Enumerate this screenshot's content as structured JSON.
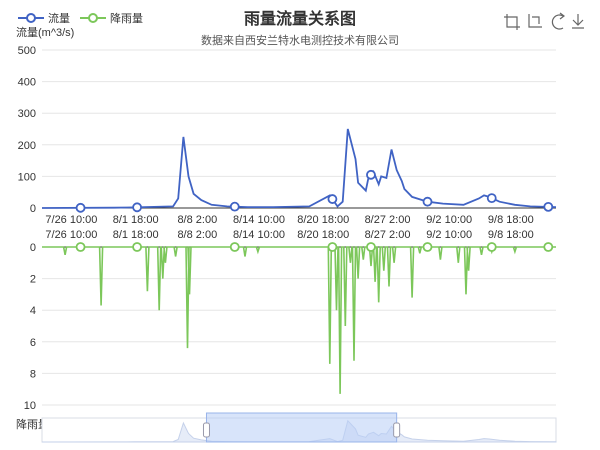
{
  "title": "雨量流量关系图",
  "subtitle": "数据来自西安兰特水电测控技术有限公司",
  "legend": [
    {
      "name": "流量",
      "color": "#4063c4"
    },
    {
      "name": "降雨量",
      "color": "#7cc75a"
    }
  ],
  "toolbox": [
    {
      "name": "zoom-icon"
    },
    {
      "name": "zoom-reset-icon"
    },
    {
      "name": "restore-icon"
    },
    {
      "name": "download-icon"
    }
  ],
  "chart_data": [
    {
      "type": "line",
      "ylabel": "流量(m^3/s)",
      "ylim": [
        0,
        500
      ],
      "yticks": [
        "0",
        "100",
        "200",
        "300",
        "400",
        "500"
      ],
      "xlim": [
        0,
        1
      ],
      "xtick_labels": [
        "7/26 10:00",
        "8/1 18:00",
        "8/8 2:00",
        "8/14 10:00",
        "8/20 18:00",
        "8/27 2:00",
        "9/2 10:00",
        "9/8 18:00"
      ],
      "grid": true,
      "series": [
        {
          "name": "流量",
          "color": "#4063c4",
          "x": [
            0,
            0.14,
            0.18,
            0.255,
            0.265,
            0.275,
            0.285,
            0.295,
            0.31,
            0.33,
            0.36,
            0.4,
            0.45,
            0.52,
            0.56,
            0.575,
            0.585,
            0.595,
            0.61,
            0.615,
            0.63,
            0.635,
            0.645,
            0.655,
            0.66,
            0.67,
            0.68,
            0.69,
            0.7,
            0.705,
            0.72,
            0.75,
            0.78,
            0.82,
            0.85,
            0.86,
            0.87,
            0.89,
            0.92,
            0.95,
            1.0
          ],
          "values": [
            0,
            1,
            2,
            5,
            30,
            225,
            100,
            45,
            25,
            10,
            5,
            3,
            3,
            5,
            40,
            5,
            20,
            250,
            155,
            80,
            55,
            95,
            115,
            75,
            100,
            95,
            185,
            120,
            85,
            60,
            35,
            20,
            14,
            10,
            30,
            40,
            35,
            20,
            10,
            5,
            3
          ]
        }
      ],
      "markers": [
        0.075,
        0.185,
        0.375,
        0.565,
        0.64,
        0.75,
        0.875,
        0.985
      ]
    },
    {
      "type": "line",
      "ylabel": "降雨量(mm)",
      "ylim": [
        0,
        10
      ],
      "inverted": true,
      "yticks": [
        "0",
        "2",
        "4",
        "6",
        "8",
        "10"
      ],
      "xlim": [
        0,
        1
      ],
      "xtick_labels": [
        "7/26 10:00",
        "8/1 18:00",
        "8/8 2:00",
        "8/14 10:00",
        "8/20 18:00",
        "8/27 2:00",
        "9/2 10:00",
        "9/8 18:00"
      ],
      "grid": true,
      "series": [
        {
          "name": "降雨量",
          "color": "#7cc75a",
          "spikes": [
            [
              0.045,
              0.5
            ],
            [
              0.115,
              3.7
            ],
            [
              0.205,
              2.8
            ],
            [
              0.228,
              4.0
            ],
            [
              0.235,
              2.0
            ],
            [
              0.24,
              1.0
            ],
            [
              0.26,
              0.6
            ],
            [
              0.283,
              6.4
            ],
            [
              0.287,
              3.0
            ],
            [
              0.395,
              0.6
            ],
            [
              0.42,
              0.3
            ],
            [
              0.56,
              7.4
            ],
            [
              0.573,
              4.0
            ],
            [
              0.58,
              9.3
            ],
            [
              0.59,
              5.0
            ],
            [
              0.6,
              1.0
            ],
            [
              0.607,
              7.2
            ],
            [
              0.615,
              2.0
            ],
            [
              0.625,
              0.8
            ],
            [
              0.64,
              1.2
            ],
            [
              0.648,
              2.2
            ],
            [
              0.655,
              3.5
            ],
            [
              0.665,
              1.5
            ],
            [
              0.675,
              2.5
            ],
            [
              0.685,
              1.0
            ],
            [
              0.72,
              3.2
            ],
            [
              0.735,
              0.4
            ],
            [
              0.775,
              0.8
            ],
            [
              0.81,
              1.0
            ],
            [
              0.825,
              3.0
            ],
            [
              0.83,
              1.5
            ],
            [
              0.855,
              0.5
            ],
            [
              0.875,
              0.3
            ],
            [
              0.92,
              0.3
            ]
          ]
        }
      ],
      "markers": [
        0.075,
        0.185,
        0.375,
        0.565,
        0.64,
        0.75,
        0.875,
        0.985
      ]
    }
  ],
  "datazoom": {
    "start": 0.32,
    "end": 0.69
  }
}
